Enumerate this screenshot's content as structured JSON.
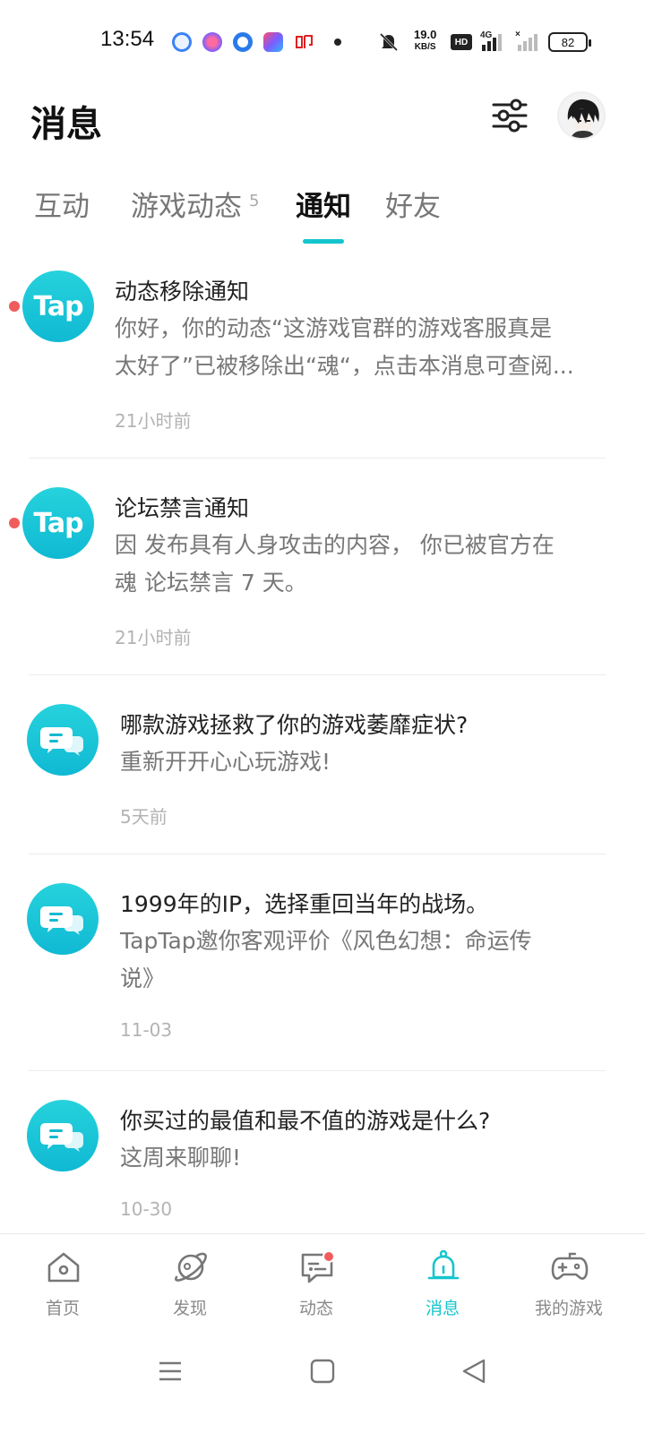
{
  "status_bar": {
    "time": "13:54",
    "net_speed_value": "19.0",
    "net_speed_unit": "KB/S",
    "hd_label": "HD",
    "network_label": "4G",
    "battery": "82"
  },
  "header": {
    "title": "消息"
  },
  "tabs": [
    {
      "label": "互动",
      "badge": ""
    },
    {
      "label": "游戏动态",
      "badge": "5"
    },
    {
      "label": "通知",
      "badge": ""
    },
    {
      "label": "好友",
      "badge": ""
    }
  ],
  "active_tab": "通知",
  "accent_color": "#15c5ce",
  "unread_color": "#f05c5c",
  "notifications": [
    {
      "icon": "tap-logo-icon",
      "unread": true,
      "title": "动态移除通知",
      "body_line1": "你好，你的动态“这游戏官群的游戏客服真是",
      "body_line2": "太好了”已被移除出“魂“，点击本消息可查阅...",
      "time": "21小时前"
    },
    {
      "icon": "tap-logo-icon",
      "unread": true,
      "title": "论坛禁言通知",
      "body_line1": "因 发布具有人身攻击的内容， 你已被官方在",
      "body_line2": "魂 论坛禁言 7 天。",
      "time": "21小时前"
    },
    {
      "icon": "chat-bubble-icon",
      "unread": false,
      "title": "哪款游戏拯救了你的游戏萎靡症状?",
      "body_line1": "重新开开心心玩游戏!",
      "body_line2": "",
      "time": "5天前"
    },
    {
      "icon": "chat-bubble-icon",
      "unread": false,
      "title": "1999年的IP，选择重回当年的战场。",
      "body_line1": "TapTap邀你客观评价《风色幻想：命运传",
      "body_line2": "说》",
      "time": "11-03"
    },
    {
      "icon": "chat-bubble-icon",
      "unread": false,
      "title": "你买过的最值和最不值的游戏是什么?",
      "body_line1": "这周来聊聊!",
      "body_line2": "",
      "time": "10-30"
    }
  ],
  "tap_logo_text": "Tap",
  "bottom_nav": [
    {
      "label": "首页",
      "icon": "home-icon"
    },
    {
      "label": "发现",
      "icon": "planet-icon"
    },
    {
      "label": "动态",
      "icon": "message-icon"
    },
    {
      "label": "消息",
      "icon": "bell-icon"
    },
    {
      "label": "我的游戏",
      "icon": "gamepad-icon"
    }
  ],
  "active_nav": "消息"
}
